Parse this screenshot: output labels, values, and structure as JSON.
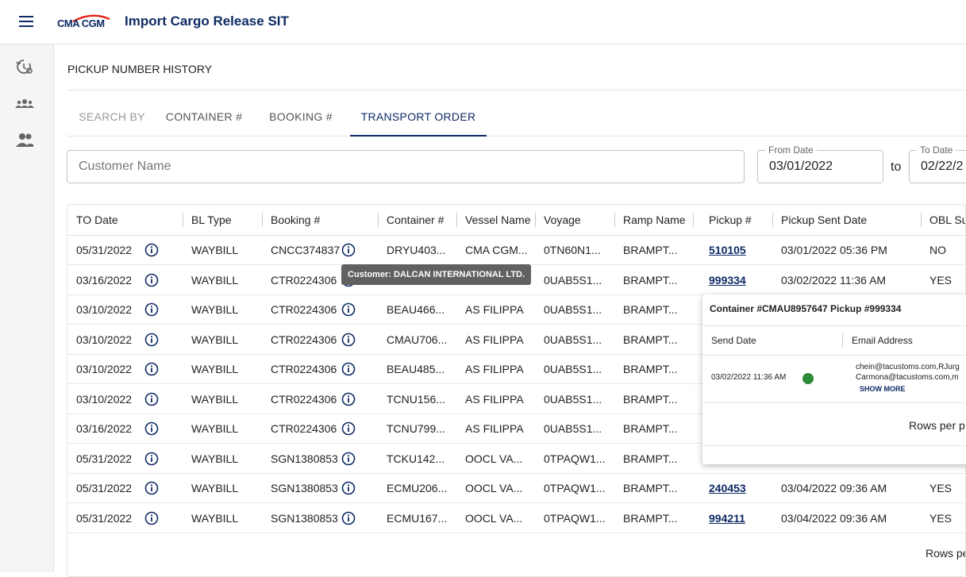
{
  "header": {
    "logo_text": "CMA CGM",
    "title": "Import Cargo Release SIT"
  },
  "sidebar": {
    "items": [
      "history-settings-icon",
      "group-icon",
      "people-icon"
    ]
  },
  "page": {
    "title": "PICKUP NUMBER HISTORY"
  },
  "tabs": [
    "SEARCH BY",
    "CONTAINER #",
    "BOOKING #",
    "TRANSPORT ORDER"
  ],
  "active_tab": "TRANSPORT ORDER",
  "search": {
    "customer_placeholder": "Customer Name"
  },
  "dates": {
    "from_label": "From Date",
    "from_value": "03/01/2022",
    "to_text": "to",
    "to_label": "To Date",
    "to_value": "02/22/2"
  },
  "table": {
    "headers": [
      "TO Date",
      "BL Type",
      "Booking #",
      "Container #",
      "Vessel Name",
      "Voyage",
      "Ramp Name",
      "Pickup #",
      "Pickup Sent Date",
      "OBL Su"
    ],
    "rows": [
      {
        "to_date": "05/31/2022",
        "bl_type": "WAYBILL",
        "booking": "CNCC374837",
        "container": "DRYU403...",
        "vessel": "CMA CGM...",
        "voyage": "0TN60N1...",
        "ramp": "BRAMPT...",
        "pickup": "510105",
        "sent": "03/01/2022 05:36 PM",
        "obl": "NO"
      },
      {
        "to_date": "03/16/2022",
        "bl_type": "WAYBILL",
        "booking": "CTR0224306",
        "container": "",
        "vessel": "",
        "voyage": "0UAB5S1...",
        "ramp": "BRAMPT...",
        "pickup": "999334",
        "sent": "03/02/2022 11:36 AM",
        "obl": "YES"
      },
      {
        "to_date": "03/10/2022",
        "bl_type": "WAYBILL",
        "booking": "CTR0224306",
        "container": "BEAU466...",
        "vessel": "AS FILIPPA",
        "voyage": "0UAB5S1...",
        "ramp": "BRAMPT...",
        "pickup": "",
        "sent": "",
        "obl": ""
      },
      {
        "to_date": "03/10/2022",
        "bl_type": "WAYBILL",
        "booking": "CTR0224306",
        "container": "CMAU706...",
        "vessel": "AS FILIPPA",
        "voyage": "0UAB5S1...",
        "ramp": "BRAMPT...",
        "pickup": "",
        "sent": "",
        "obl": ""
      },
      {
        "to_date": "03/10/2022",
        "bl_type": "WAYBILL",
        "booking": "CTR0224306",
        "container": "BEAU485...",
        "vessel": "AS FILIPPA",
        "voyage": "0UAB5S1...",
        "ramp": "BRAMPT...",
        "pickup": "",
        "sent": "",
        "obl": ""
      },
      {
        "to_date": "03/10/2022",
        "bl_type": "WAYBILL",
        "booking": "CTR0224306",
        "container": "TCNU156...",
        "vessel": "AS FILIPPA",
        "voyage": "0UAB5S1...",
        "ramp": "BRAMPT...",
        "pickup": "",
        "sent": "",
        "obl": ""
      },
      {
        "to_date": "03/16/2022",
        "bl_type": "WAYBILL",
        "booking": "CTR0224306",
        "container": "TCNU799...",
        "vessel": "AS FILIPPA",
        "voyage": "0UAB5S1...",
        "ramp": "BRAMPT...",
        "pickup": "",
        "sent": "",
        "obl": ""
      },
      {
        "to_date": "05/31/2022",
        "bl_type": "WAYBILL",
        "booking": "SGN1380853",
        "container": "TCKU142...",
        "vessel": "OOCL VA...",
        "voyage": "0TPAQW1...",
        "ramp": "BRAMPT...",
        "pickup": "",
        "sent": "",
        "obl": ""
      },
      {
        "to_date": "05/31/2022",
        "bl_type": "WAYBILL",
        "booking": "SGN1380853",
        "container": "ECMU206...",
        "vessel": "OOCL VA...",
        "voyage": "0TPAQW1...",
        "ramp": "BRAMPT...",
        "pickup": "240453",
        "sent": "03/04/2022 09:36 AM",
        "obl": "YES"
      },
      {
        "to_date": "05/31/2022",
        "bl_type": "WAYBILL",
        "booking": "SGN1380853",
        "container": "ECMU167...",
        "vessel": "OOCL VA...",
        "voyage": "0TPAQW1...",
        "ramp": "BRAMPT...",
        "pickup": "994211",
        "sent": "03/04/2022 09:36 AM",
        "obl": "YES"
      }
    ],
    "rows_per_page_label": "Rows pe"
  },
  "tooltip": {
    "text": "Customer: DALCAN INTERNATIONAL LTD."
  },
  "popup": {
    "title": "Container #CMAU8957647 Pickup #999334",
    "col_send_date": "Send Date",
    "col_email": "Email Address",
    "row_date": "03/02/2022 11:36 AM",
    "row_status_color": "#2e8b3a",
    "email_line1": "chein@tacustoms.com,RJurg",
    "email_line2": "Carmona@tacustoms.com,m",
    "show_more": "SHOW MORE",
    "rows_per_page": "Rows per p"
  },
  "colors": {
    "brand": "#0e2a64",
    "status_ok": "#2e8b3a"
  }
}
